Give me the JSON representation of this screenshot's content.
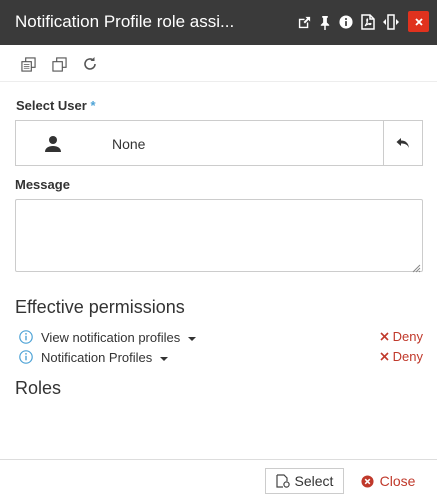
{
  "window": {
    "title": "Notification Profile role assi...",
    "icons": [
      "popout-icon",
      "pin-icon",
      "info-icon",
      "pdf-icon",
      "resize-width-icon"
    ],
    "close_icon": "close-icon"
  },
  "toolbar": {
    "icons": [
      "copy-icon",
      "paste-icon",
      "refresh-icon"
    ]
  },
  "form": {
    "select_user_label": "Select User",
    "required_marker": "*",
    "user_value": "None",
    "message_label": "Message",
    "message_value": ""
  },
  "effective_permissions": {
    "title": "Effective permissions",
    "items": [
      {
        "label": "View notification profiles",
        "status": "Deny"
      },
      {
        "label": "Notification Profiles",
        "status": "Deny"
      }
    ]
  },
  "roles": {
    "title": "Roles"
  },
  "footer": {
    "select_label": "Select",
    "close_label": "Close"
  },
  "colors": {
    "titlebar": "#3a3a3a",
    "close_button": "#e0321e",
    "deny": "#c0392b",
    "info": "#4ea3d6"
  }
}
